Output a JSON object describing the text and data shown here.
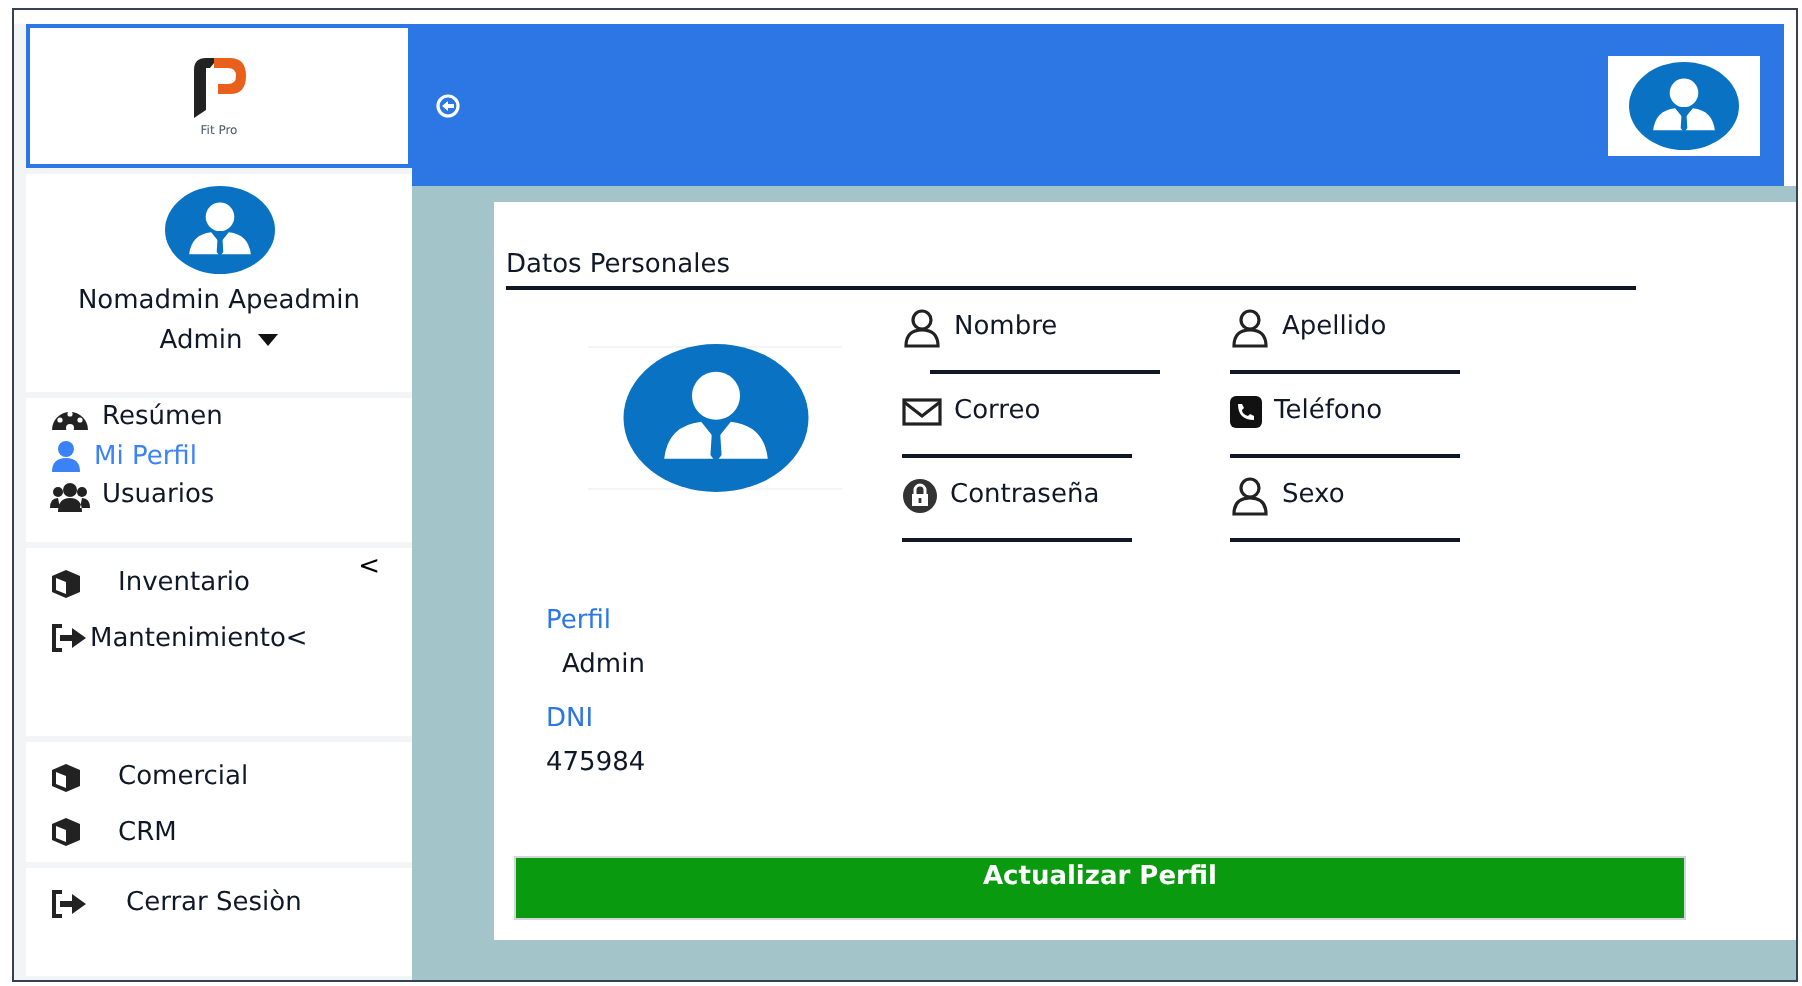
{
  "logo": {
    "caption": "Fit Pro"
  },
  "user": {
    "name": "Nomadmin Apeadmin",
    "role": "Admin"
  },
  "menu_groups": [
    {
      "items": [
        {
          "label": "Resúmen",
          "kind": "gauge",
          "selected": false
        },
        {
          "label": "Mi Perfil",
          "kind": "user",
          "selected": true
        },
        {
          "label": "Usuarios",
          "kind": "users",
          "selected": false
        }
      ]
    },
    {
      "collapse": "<",
      "items": [
        {
          "label": "Inventario",
          "kind": "cube",
          "selected": false
        },
        {
          "label": "Mantenimiento<",
          "kind": "signin",
          "selected": false
        }
      ]
    },
    {
      "items": [
        {
          "label": "Comercial",
          "kind": "cube",
          "selected": false
        },
        {
          "label": "CRM",
          "kind": "cube",
          "selected": false
        }
      ]
    },
    {
      "items": [
        {
          "label": "Cerrar Sesiòn",
          "kind": "signin",
          "selected": false
        }
      ]
    }
  ],
  "section_title": "Datos Personales",
  "fields": [
    {
      "label": "Nombre",
      "kind": "person"
    },
    {
      "label": "Apellido",
      "kind": "person"
    },
    {
      "label": "Correo",
      "kind": "mail"
    },
    {
      "label": "Teléfono",
      "kind": "phone"
    },
    {
      "label": "Contraseña",
      "kind": "lock"
    },
    {
      "label": "Sexo",
      "kind": "person"
    }
  ],
  "info": [
    {
      "label": "Perfil",
      "value": "Admin"
    },
    {
      "label": "DNI",
      "value": "475984"
    }
  ],
  "button": "Actualizar Perfil"
}
